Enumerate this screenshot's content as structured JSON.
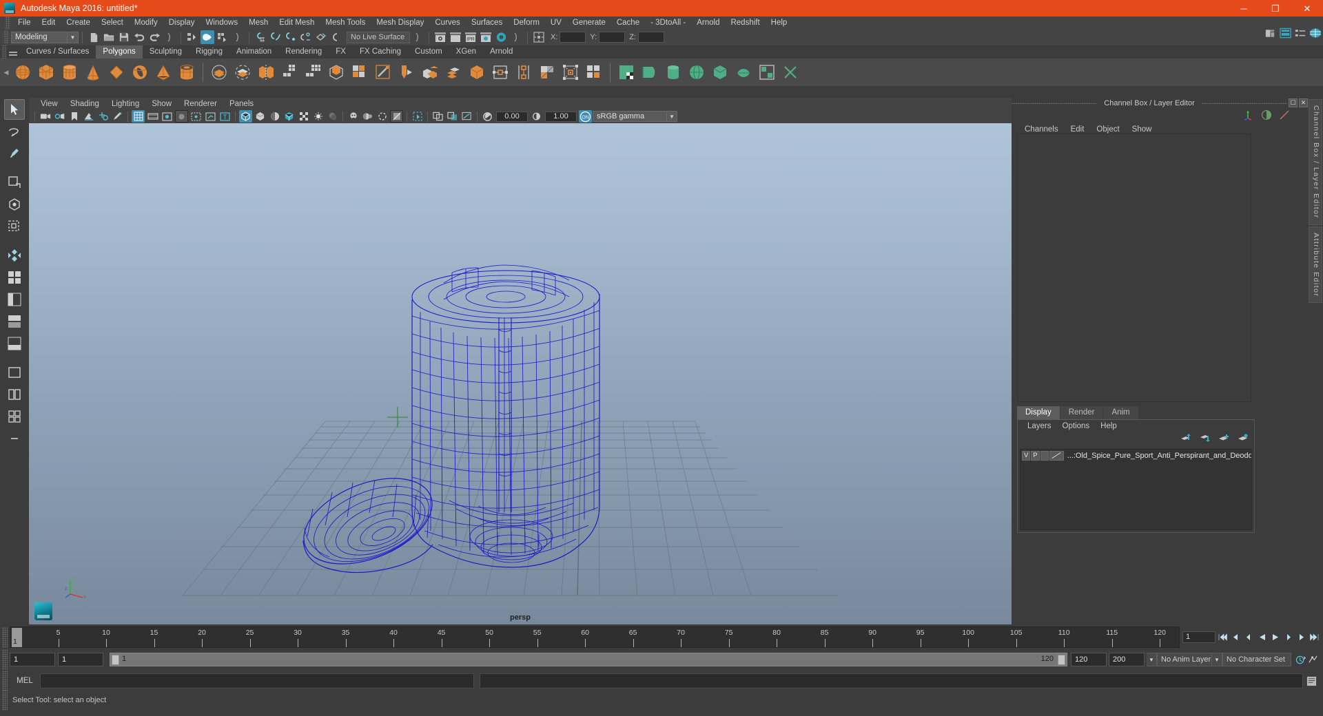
{
  "window": {
    "title": "Autodesk Maya 2016: untitled*",
    "app_icon": "maya-logo-icon",
    "controls": {
      "minimize": "─",
      "maximize": "❐",
      "close": "✕"
    },
    "titlebar_color": "#e64a19"
  },
  "menubar": {
    "items": [
      "File",
      "Edit",
      "Create",
      "Select",
      "Modify",
      "Display",
      "Windows",
      "Mesh",
      "Edit Mesh",
      "Mesh Tools",
      "Mesh Display",
      "Curves",
      "Surfaces",
      "Deform",
      "UV",
      "Generate",
      "Cache",
      "- 3DtoAll -",
      "Arnold",
      "Redshift",
      "Help"
    ]
  },
  "statusbar": {
    "mode": "Modeling",
    "live_surface": "No Live Surface",
    "coords": [
      {
        "label": "X:",
        "value": ""
      },
      {
        "label": "Y:",
        "value": ""
      },
      {
        "label": "Z:",
        "value": ""
      }
    ],
    "icons_left": [
      "new-scene-icon",
      "open-scene-icon",
      "save-scene-icon",
      "undo-icon",
      "redo-icon"
    ],
    "icons_select_mode": [
      "select-by-hierarchy-icon",
      "select-by-object-type-icon",
      "select-by-component-type-icon"
    ],
    "icons_snap": [
      "snap-to-grid-icon",
      "snap-to-curve-icon",
      "snap-to-point-icon",
      "snap-to-projected-center-icon",
      "snap-to-view-plane-icon",
      "make-live-icon"
    ],
    "icons_render": [
      "render-current-frame-icon",
      "render-sequence-icon",
      "ipr-render-icon",
      "render-settings-icon",
      "hypershade-icon"
    ],
    "icons_right": [
      "show-hide-channel-box-icon",
      "show-hide-attribute-editor-icon",
      "show-hide-tool-settings-icon",
      "show-hide-outliner-icon"
    ]
  },
  "shelf": {
    "tabs": [
      "Curves / Surfaces",
      "Polygons",
      "Sculpting",
      "Rigging",
      "Animation",
      "Rendering",
      "FX",
      "FX Caching",
      "Custom",
      "XGen",
      "Arnold"
    ],
    "selected_tab": "Polygons",
    "items": [
      "poly-sphere-icon",
      "poly-cube-icon",
      "poly-cylinder-icon",
      "poly-cone-icon",
      "poly-plane-icon",
      "poly-torus-icon",
      "poly-pyramid-icon",
      "poly-pipe-icon",
      "boolean-union-icon",
      "boolean-difference-icon",
      "combine-icon",
      "separate-icon",
      "smooth-icon",
      "mirror-geometry-icon",
      "extrude-icon",
      "bevel-icon",
      "multi-cut-icon",
      "target-weld-icon",
      "bridge-icon",
      "append-polygon-icon",
      "insert-edge-loop-icon",
      "offset-edge-loop-icon",
      "connect-icon",
      "crease-icon",
      "sculpt-icon",
      "uv-editor-icon",
      "uv-planar-icon",
      "uv-cylindrical-icon",
      "uv-spherical-icon",
      "uv-automatic-icon",
      "uv-unfold-icon",
      "uv-layout-icon"
    ]
  },
  "toolbox": {
    "items": [
      "select-tool-icon",
      "lasso-select-tool-icon",
      "paint-select-tool-icon",
      "move-tool-icon",
      "rotate-tool-icon",
      "scale-tool-icon",
      "last-tool-used-icon",
      "four-view-layout-icon",
      "persp-outliner-layout-icon",
      "persp-graph-layout-icon",
      "persp-hypershade-layout-icon",
      "single-perspective-layout-icon",
      "two-pane-layout-icon",
      "four-pane-layout-icon",
      "more-layouts-icon"
    ],
    "selected": "select-tool-icon"
  },
  "viewport": {
    "menus": [
      "View",
      "Shading",
      "Lighting",
      "Show",
      "Renderer",
      "Panels"
    ],
    "toolbar": {
      "icons": [
        "select-camera-icon",
        "lock-camera-icon",
        "bookmark-icon",
        "image-plane-icon",
        "two-d-pan-zoom-icon",
        "grease-pencil-icon",
        "grid-icon",
        "film-gate-icon",
        "resolution-gate-icon",
        "gate-mask-icon",
        "film-origin-icon",
        "xray-mode-icon",
        "xray-joints-icon",
        "wireframe-icon",
        "smooth-shade-icon",
        "shade-wireframe-icon",
        "textured-icon",
        "checker-icon",
        "use-lights-icon",
        "shadows-icon",
        "ambient-occlusion-icon",
        "motion-blur-icon",
        "multisample-icon",
        "isolate-select-icon",
        "mask-display-icon",
        "selection-highlight-icon",
        "xray-component-icon"
      ],
      "exposure_value": "0.00",
      "gamma_value": "1.00",
      "view_transform": "sRGB gamma",
      "color_management_enabled": "ON",
      "active_icons": [
        "grid-icon",
        "xray-mode-icon",
        "wireframe-icon"
      ]
    },
    "camera_label": "persp",
    "axis_gizmo": {
      "x": "x",
      "y": "y",
      "z": "z"
    },
    "model": {
      "name": "Old_Spice_Pure_Sport_Anti_Perspirant_and_Deodorant",
      "display": "wireframe",
      "wire_color": "#1515cc"
    }
  },
  "right_panel": {
    "title": "Channel Box / Layer Editor",
    "title_buttons": [
      "undock-icon",
      "close-icon"
    ],
    "tool_icons": [
      "move-tool-axis-icon",
      "contrast-icon",
      "slope-icon"
    ],
    "channelbox_menus": [
      "Channels",
      "Edit",
      "Object",
      "Show"
    ],
    "vertical_tabs": [
      "Channel Box / Layer Editor",
      "Attribute Editor"
    ],
    "layer_editor": {
      "tabs": [
        "Display",
        "Render",
        "Anim"
      ],
      "selected_tab": "Display",
      "menus": [
        "Layers",
        "Options",
        "Help"
      ],
      "icons": [
        "move-layer-up-icon",
        "move-layer-down-icon",
        "new-layer-icon",
        "new-layer-from-selected-icon"
      ],
      "layers": [
        {
          "visibility": "V",
          "playback": "P",
          "shading": "",
          "color_swatch": "",
          "name": "...:Old_Spice_Pure_Sport_Anti_Perspirant_and_Deodoran"
        }
      ]
    }
  },
  "timeline": {
    "ticks": [
      "5",
      "10",
      "15",
      "20",
      "25",
      "30",
      "35",
      "40",
      "45",
      "50",
      "55",
      "60",
      "65",
      "70",
      "75",
      "80",
      "85",
      "90",
      "95",
      "100",
      "105",
      "110",
      "115",
      "120"
    ],
    "current_frame": "1",
    "current_frame_field": "1",
    "playback_buttons": [
      "go-to-start-icon",
      "step-back-key-icon",
      "step-back-frame-icon",
      "play-backwards-icon",
      "play-forwards-icon",
      "step-forward-frame-icon",
      "step-forward-key-icon",
      "go-to-end-icon"
    ]
  },
  "range_slider": {
    "anim_start": "1",
    "range_start": "1",
    "slider_start_label": "1",
    "slider_end_label": "120",
    "range_end": "120",
    "anim_end": "200",
    "anim_layer": "No Anim Layer",
    "character_set": "No Character Set",
    "auto_key_icon": "auto-keyframe-icon",
    "anim_prefs_icon": "animation-preferences-icon"
  },
  "command_line": {
    "label": "MEL",
    "input_value": "",
    "output_value": ""
  },
  "help_line": {
    "text": "Select Tool: select an object"
  }
}
